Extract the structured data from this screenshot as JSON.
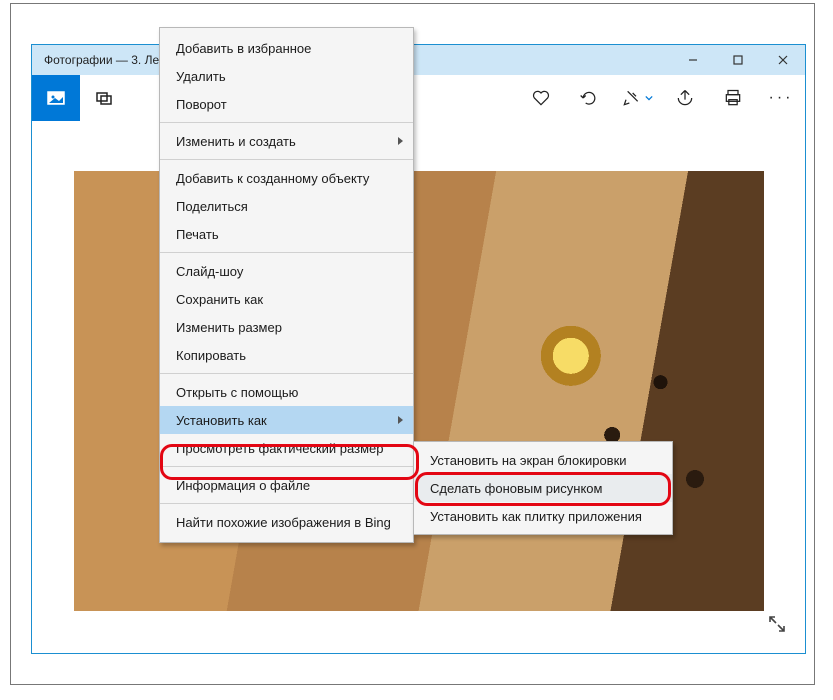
{
  "window": {
    "title": "Фотографии — 3. Ле"
  },
  "context_menu": {
    "items": [
      {
        "label": "Добавить в избранное"
      },
      {
        "label": "Удалить"
      },
      {
        "label": "Поворот"
      }
    ],
    "group2": [
      {
        "label": "Изменить и создать",
        "submenu": true
      }
    ],
    "group3": [
      {
        "label": "Добавить к созданному объекту"
      },
      {
        "label": "Поделиться"
      },
      {
        "label": "Печать"
      }
    ],
    "group4": [
      {
        "label": "Слайд-шоу"
      },
      {
        "label": "Сохранить как"
      },
      {
        "label": "Изменить размер"
      },
      {
        "label": "Копировать"
      }
    ],
    "group5": [
      {
        "label": "Открыть с помощью"
      },
      {
        "label": "Установить как",
        "submenu": true,
        "highlight": true
      },
      {
        "label": "Просмотреть фактический размер"
      }
    ],
    "group6": [
      {
        "label": "Информация о файле"
      }
    ],
    "group7": [
      {
        "label": "Найти похожие изображения в Bing"
      }
    ]
  },
  "submenu": {
    "items": [
      {
        "label": "Установить на экран блокировки"
      },
      {
        "label": "Сделать фоновым рисунком",
        "highlight": true
      },
      {
        "label": "Установить как плитку приложения"
      }
    ]
  }
}
